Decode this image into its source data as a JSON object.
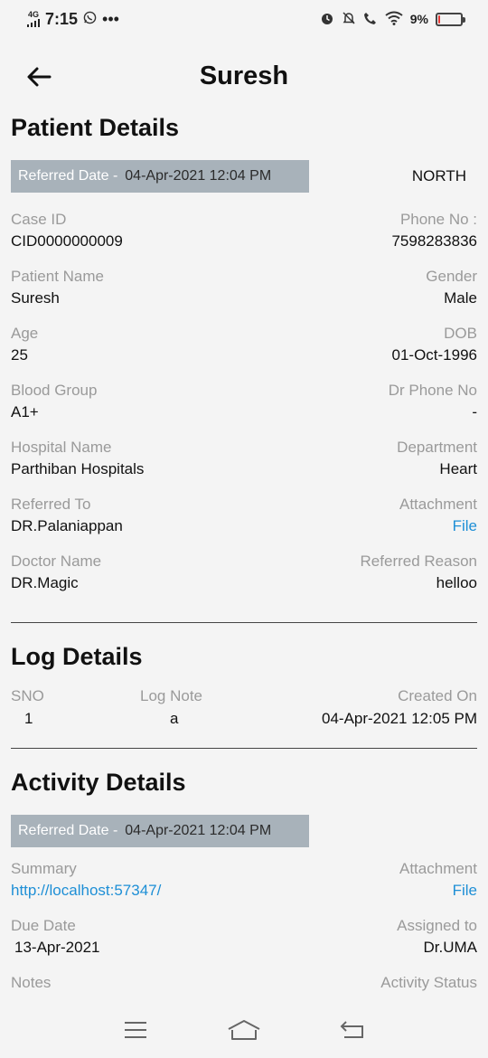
{
  "status_bar": {
    "network": "4G",
    "time": "7:15",
    "extra": "•••",
    "battery": "9%",
    "battery_level": 0.09,
    "battery_color": "#e53935"
  },
  "header": {
    "title": "Suresh"
  },
  "patient_details": {
    "heading": "Patient Details",
    "referred_label": "Referred Date -",
    "referred_date": "04-Apr-2021 12:04 PM",
    "region": "NORTH",
    "fields": [
      {
        "left_label": "Case ID",
        "left_value": "CID0000000009",
        "right_label": "Phone No :",
        "right_value": "7598283836"
      },
      {
        "left_label": "Patient Name",
        "left_value": "Suresh",
        "right_label": "Gender",
        "right_value": "Male"
      },
      {
        "left_label": "Age",
        "left_value": "25",
        "right_label": "DOB",
        "right_value": "01-Oct-1996"
      },
      {
        "left_label": "Blood Group",
        "left_value": "A1+",
        "right_label": "Dr Phone No",
        "right_value": "-"
      },
      {
        "left_label": "Hospital Name",
        "left_value": "Parthiban Hospitals",
        "right_label": "Department",
        "right_value": "Heart"
      },
      {
        "left_label": "Referred To",
        "left_value": "DR.Palaniappan",
        "right_label": "Attachment",
        "right_value": "File"
      },
      {
        "left_label": "Doctor Name",
        "left_value": "DR.Magic",
        "right_label": "Referred Reason",
        "right_value": "helloo"
      }
    ]
  },
  "log_details": {
    "heading": "Log Details",
    "columns": [
      "SNO",
      "Log Note",
      "Created On"
    ],
    "rows": [
      [
        "1",
        "a",
        "04-Apr-2021 12:05 PM"
      ]
    ]
  },
  "activity_details": {
    "heading": "Activity Details",
    "referred_label": "Referred Date -",
    "referred_date": "04-Apr-2021 12:04 PM",
    "fields": [
      {
        "left_label": "Summary",
        "left_value": "http://localhost:57347/",
        "right_label": "Attachment",
        "right_value": "File"
      },
      {
        "left_label": "Due Date",
        "left_value": "13-Apr-2021",
        "right_label": "Assigned to",
        "right_value": "Dr.UMA"
      },
      {
        "left_label": "Notes",
        "left_value": "",
        "right_label": "Activity Status",
        "right_value": ""
      }
    ]
  },
  "colors": {
    "link": "#1e8fd6",
    "badge_bg": "#a8b2ba",
    "label_gray": "#9a9a9a"
  },
  "icons": {
    "back": "arrow-left-icon",
    "menu": "menu-icon",
    "home": "home-icon",
    "nav_back": "return-icon"
  }
}
